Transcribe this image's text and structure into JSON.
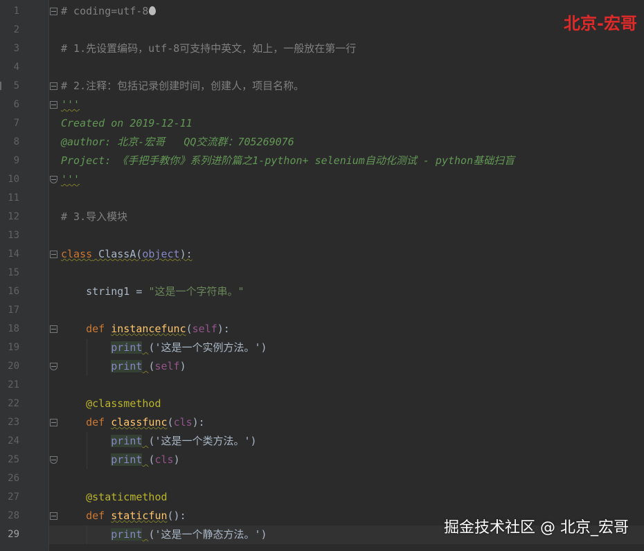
{
  "editor": {
    "active_line": 29,
    "watermark_top": "北京-宏哥",
    "watermark_bottom": "掘金技术社区 @ 北京_宏哥",
    "lines": [
      {
        "n": "1",
        "segments": [
          {
            "t": "# coding=utf-8",
            "c": "cmt"
          }
        ]
      },
      {
        "n": "2",
        "segments": []
      },
      {
        "n": "3",
        "segments": [
          {
            "t": "# 1.先设置编码，utf-8可支持中英文，如上，一般放在第一行",
            "c": "cmt"
          }
        ]
      },
      {
        "n": "4",
        "segments": []
      },
      {
        "n": "5",
        "segments": [
          {
            "t": "# 2.注释：包括记录创建时间，创建人，项目名称。",
            "c": "cmt"
          }
        ]
      },
      {
        "n": "6",
        "segments": [
          {
            "t": "'''",
            "c": "doc wavy"
          }
        ]
      },
      {
        "n": "7",
        "segments": [
          {
            "t": "Created on 2019-12-11",
            "c": "doc"
          }
        ]
      },
      {
        "n": "8",
        "segments": [
          {
            "t": "@author: 北京-宏哥   QQ交流群：705269076",
            "c": "doc"
          }
        ]
      },
      {
        "n": "9",
        "segments": [
          {
            "t": "Project: 《手把手教你》系列进阶篇之1-python+ selenium自动化测试 - python基础扫盲",
            "c": "doc"
          }
        ]
      },
      {
        "n": "10",
        "segments": [
          {
            "t": "'''",
            "c": "doc wavy"
          }
        ]
      },
      {
        "n": "11",
        "segments": []
      },
      {
        "n": "12",
        "segments": [
          {
            "t": "# 3.导入模块",
            "c": "cmt"
          }
        ]
      },
      {
        "n": "13",
        "segments": []
      },
      {
        "n": "14",
        "segments": [
          {
            "t": "class",
            "c": "kw wavy"
          },
          {
            "t": " ClassA(",
            "c": "wavy"
          },
          {
            "t": "object",
            "c": "builtin wavy"
          },
          {
            "t": "):",
            "c": "wavy"
          }
        ]
      },
      {
        "n": "15",
        "segments": []
      },
      {
        "n": "16",
        "segments": [
          {
            "t": "    string1 = ",
            "c": ""
          },
          {
            "t": "\"这是一个字符串。\"",
            "c": "str"
          }
        ]
      },
      {
        "n": "17",
        "segments": []
      },
      {
        "n": "18",
        "segments": [
          {
            "t": "    ",
            "c": ""
          },
          {
            "t": "def",
            "c": "kw"
          },
          {
            "t": " ",
            "c": ""
          },
          {
            "t": "instancefunc",
            "c": "fn wavy"
          },
          {
            "t": "(",
            "c": ""
          },
          {
            "t": "self",
            "c": "selfc"
          },
          {
            "t": "):",
            "c": ""
          }
        ]
      },
      {
        "n": "19",
        "segments": [
          {
            "t": "        ",
            "c": ""
          },
          {
            "t": "print",
            "c": "builtin printbg"
          },
          {
            "t": " ",
            "c": "wavy"
          },
          {
            "t": "('这是一个实例方法。')",
            "c": ""
          }
        ]
      },
      {
        "n": "20",
        "segments": [
          {
            "t": "        ",
            "c": ""
          },
          {
            "t": "print",
            "c": "builtin printbg"
          },
          {
            "t": " ",
            "c": "wavy"
          },
          {
            "t": "(",
            "c": ""
          },
          {
            "t": "self",
            "c": "selfc"
          },
          {
            "t": ")",
            "c": ""
          }
        ]
      },
      {
        "n": "21",
        "segments": []
      },
      {
        "n": "22",
        "segments": [
          {
            "t": "    @classmethod",
            "c": "deco"
          }
        ]
      },
      {
        "n": "23",
        "segments": [
          {
            "t": "    ",
            "c": ""
          },
          {
            "t": "def",
            "c": "kw"
          },
          {
            "t": " ",
            "c": ""
          },
          {
            "t": "classfunc",
            "c": "fn wavy"
          },
          {
            "t": "(",
            "c": ""
          },
          {
            "t": "cls",
            "c": "selfc"
          },
          {
            "t": "):",
            "c": ""
          }
        ]
      },
      {
        "n": "24",
        "segments": [
          {
            "t": "        ",
            "c": ""
          },
          {
            "t": "print",
            "c": "builtin printbg"
          },
          {
            "t": " ",
            "c": "wavy"
          },
          {
            "t": "('这是一个类方法。')",
            "c": ""
          }
        ]
      },
      {
        "n": "25",
        "segments": [
          {
            "t": "        ",
            "c": ""
          },
          {
            "t": "print",
            "c": "builtin printbg"
          },
          {
            "t": " ",
            "c": "wavy"
          },
          {
            "t": "(",
            "c": ""
          },
          {
            "t": "cls",
            "c": "selfc"
          },
          {
            "t": ")",
            "c": ""
          }
        ]
      },
      {
        "n": "26",
        "segments": []
      },
      {
        "n": "27",
        "segments": [
          {
            "t": "    @staticmethod",
            "c": "deco"
          }
        ]
      },
      {
        "n": "28",
        "segments": [
          {
            "t": "    ",
            "c": ""
          },
          {
            "t": "def",
            "c": "kw"
          },
          {
            "t": " ",
            "c": ""
          },
          {
            "t": "staticfun",
            "c": "fn wavy"
          },
          {
            "t": "():",
            "c": ""
          }
        ]
      },
      {
        "n": "29",
        "segments": [
          {
            "t": "        ",
            "c": ""
          },
          {
            "t": "print",
            "c": "builtin printbg"
          },
          {
            "t": " ",
            "c": "wavy"
          },
          {
            "t": "('这是一个静态方法。')",
            "c": ""
          }
        ]
      }
    ]
  },
  "colors": {
    "background": "#2b2b2b",
    "gutter": "#313335",
    "comment": "#808080",
    "docstring": "#629755",
    "keyword": "#cc7832",
    "function": "#ffc66d",
    "builtin": "#8888c6",
    "self": "#94558d",
    "string": "#6a8759",
    "decorator": "#bbb529",
    "watermark_top": "#e02a2a"
  }
}
